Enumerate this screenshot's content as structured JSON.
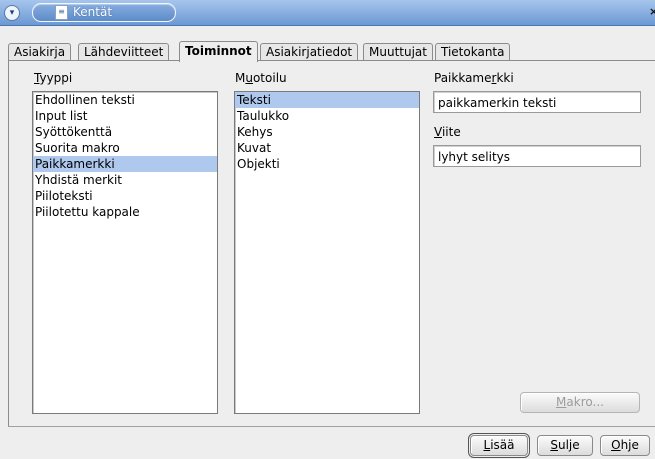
{
  "window": {
    "title": "Kentät",
    "menu_glyph": "▾",
    "close_glyph": "×"
  },
  "tabs": [
    {
      "label": "Asiakirja"
    },
    {
      "label": "Lähdeviitteet"
    },
    {
      "label": "Toiminnot"
    },
    {
      "label": "Asiakirjatiedot"
    },
    {
      "label": "Muuttujat"
    },
    {
      "label": "Tietokanta"
    }
  ],
  "active_tab": "Toiminnot",
  "type_section": {
    "label_first": "T",
    "label_rest": "yyppi",
    "items": [
      "Ehdollinen teksti",
      "Input list",
      "Syöttökenttä",
      "Suorita makro",
      "Paikkamerkki",
      "Yhdistä merkit",
      "Piiloteksti",
      "Piilotettu kappale"
    ],
    "selected": "Paikkamerkki"
  },
  "format_section": {
    "label_first": "M",
    "label_under": "u",
    "label_rest": "otoilu",
    "items": [
      "Teksti",
      "Taulukko",
      "Kehys",
      "Kuvat",
      "Objekti"
    ],
    "selected": "Teksti"
  },
  "placeholder_field": {
    "label_pre": "Paikkame",
    "label_under": "r",
    "label_post": "kki",
    "value": "paikkamerkin teksti"
  },
  "reference_field": {
    "label_under": "V",
    "label_rest": "iite",
    "value": "lyhyt selitys"
  },
  "buttons": {
    "macro_under": "M",
    "macro_rest": "akro...",
    "insert_under": "L",
    "insert_rest": "isää",
    "close_under": "S",
    "close_rest": "ulje",
    "help_under": "O",
    "help_rest": "hje"
  }
}
